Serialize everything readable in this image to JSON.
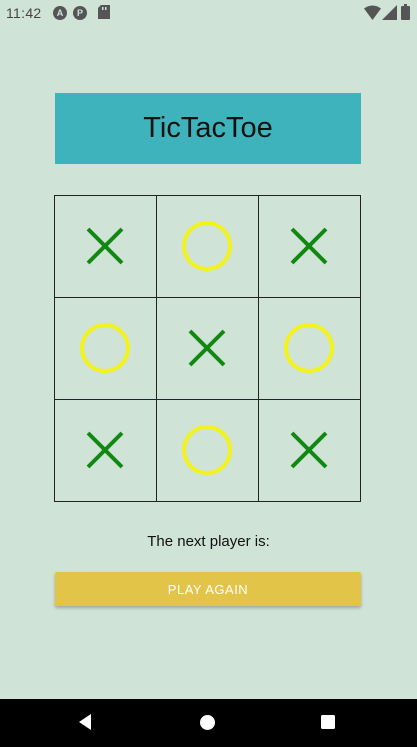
{
  "status": {
    "time": "11:42",
    "icons": [
      "app-a-icon",
      "app-p-icon",
      "sd-card-icon",
      "wifi-icon",
      "signal-icon",
      "battery-icon"
    ]
  },
  "title": "TicTacToe",
  "board": {
    "cells": [
      "X",
      "O",
      "X",
      "O",
      "X",
      "O",
      "X",
      "O",
      "X"
    ],
    "colors": {
      "X": "#118811",
      "O": "#f2f21e"
    }
  },
  "next_player_label": "The next player is:",
  "play_again_label": "PLAY AGAIN",
  "nav": {
    "icons": [
      "back-icon",
      "home-icon",
      "recents-icon"
    ]
  }
}
